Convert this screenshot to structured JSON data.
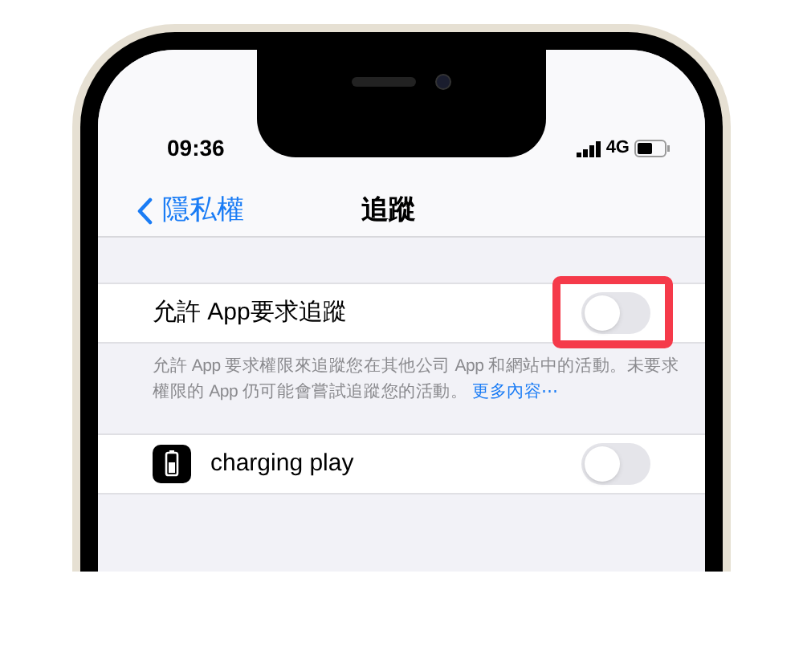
{
  "status_bar": {
    "time": "09:36",
    "network": "4G"
  },
  "nav_bar": {
    "back": "隱私權",
    "title": "追蹤"
  },
  "rows": [
    {
      "kind": "toggle",
      "label": "允許 App要求追蹤",
      "on": false,
      "highlighted": true
    },
    {
      "kind": "footer",
      "text": "允許 App 要求權限來追蹤您在其他公司 App 和網站中的活動。未要求權限的 App 仍可能會嘗試追蹤您的活動。",
      "link": "更多內容⋯"
    },
    {
      "kind": "app",
      "label": "charging play",
      "on": false,
      "highlighted": false
    }
  ]
}
